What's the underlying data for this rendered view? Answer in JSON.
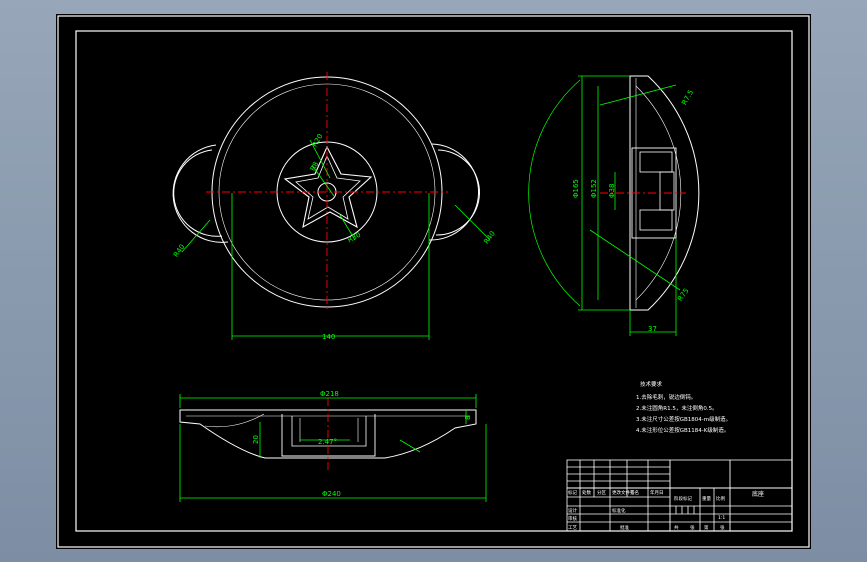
{
  "drawing": {
    "top_view": {
      "dims": {
        "lug_left_r": "R40",
        "lug_right_r": "R40",
        "width": "140",
        "hub_r1": "R20",
        "hub_r2": "R30",
        "hub_r3": "R8"
      }
    },
    "side_view": {
      "dims": {
        "d_outer": "Φ165",
        "d_inner": "Φ152",
        "d_hub": "Φ38",
        "r_top": "R7.5",
        "r_bottom": "R75",
        "thickness": "37"
      }
    },
    "front_view": {
      "dims": {
        "d_top": "Φ218",
        "d_bottom": "Φ240",
        "angle": "2.47°",
        "height_right": "8",
        "height_left": "20"
      }
    },
    "notes": {
      "title": "技术要求",
      "lines": [
        "1.去除毛刺，锐边倒钝。",
        "2.未注圆角R1.5，未注倒角0.5。",
        "3.未注尺寸公差按GB1804-m级制造。",
        "4.未注形位公差按GB1184-K级制造。"
      ]
    },
    "title_block": {
      "part_name": "底座",
      "scale": "1:1",
      "labels": [
        "标记",
        "处数",
        "分区",
        "更改文件号",
        "签名",
        "年月日"
      ],
      "labels2": [
        "设计",
        "标准化",
        "阶段标记",
        "重量",
        "比例"
      ],
      "labels3": [
        "审核",
        "工艺",
        "批准",
        "共",
        "张",
        "第",
        "张"
      ]
    }
  },
  "colors": {
    "background": "#000000",
    "frame": "#ffffff",
    "dimension": "#00ff00",
    "centerline": "#ff0000",
    "outline": "#ffffff",
    "notes": "#ffffff"
  }
}
